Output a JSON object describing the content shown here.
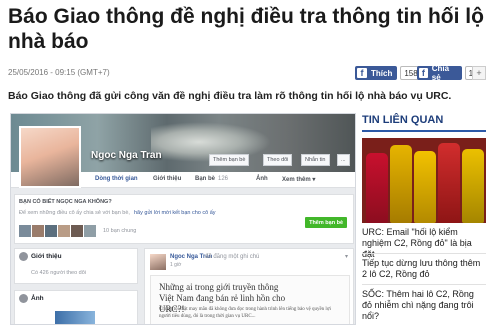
{
  "article": {
    "headline": "Báo Giao thông đề nghị điều tra thông tin hối lộ nhà báo",
    "timestamp": "25/05/2016 - 09:15 (GMT+7)",
    "lead": "Báo Giao thông đã gửi công văn đề nghị điều tra làm rõ thông tin hối lộ nhà báo vụ URC."
  },
  "share": {
    "like_label": "Thích",
    "like_count": "158",
    "share_label": "Chia sẻ",
    "share_count": "158",
    "gplus_label": "+"
  },
  "facebook": {
    "profile_name": "Ngoc Nga Tran",
    "add_friend_label": "Thêm bạn bè",
    "follow_label": "Theo dõi",
    "message_label": "Nhắn tin",
    "more_label": "...",
    "tabs": [
      "Dòng thời gian",
      "Giới thiệu",
      "Bạn bè",
      "Ảnh",
      "Xem thêm ▾"
    ],
    "friends_count_badge": "126",
    "know_question": "BẠN CÓ BIẾT NGỌC NGA KHÔNG?",
    "know_desc": "Để xem những điều cô ấy chia sẻ với bạn bè,",
    "know_link": "hãy gửi lời mời kết bạn cho cô ấy",
    "mutual_friends": "10 bạn chung",
    "add_friend_button": "Thêm bạn bè",
    "intro_title": "Giới thiệu",
    "intro_followers": "Có 426 người theo dõi",
    "photos_title": "Ảnh",
    "post_author": "Ngoc Nga Tran",
    "post_action": "đã đăng một ghi chú",
    "post_time": "1 giờ",
    "post_title": "Những ai trong giới truyền thông Việt Nam đang bán rẻ linh hồn cho URC?!",
    "post_body": "Chúng tôi thật may mắn đã không đưa đọc trong hành trình lên tiếng bảo vệ quyền lợi người tiêu dùng, đó là trong thời gian vụ URC..."
  },
  "sidebar": {
    "title": "TIN LIÊN QUAN",
    "items": [
      "URC: Email \"hối lộ kiểm nghiệm C2, Rồng đỏ\" là bịa đặt",
      "Tiếp tục dừng lưu thông thêm 2 lô C2, Rồng đỏ",
      "SỐC: Thêm hai lô C2, Rồng đỏ nhiễm chì nặng đang trôi nổi?"
    ]
  },
  "colors": {
    "facebook_blue": "#3b5998",
    "sidebar_title": "#1d3d7a",
    "sidebar_rule": "#2d5aa8",
    "add_friend_green": "#42b72a"
  }
}
